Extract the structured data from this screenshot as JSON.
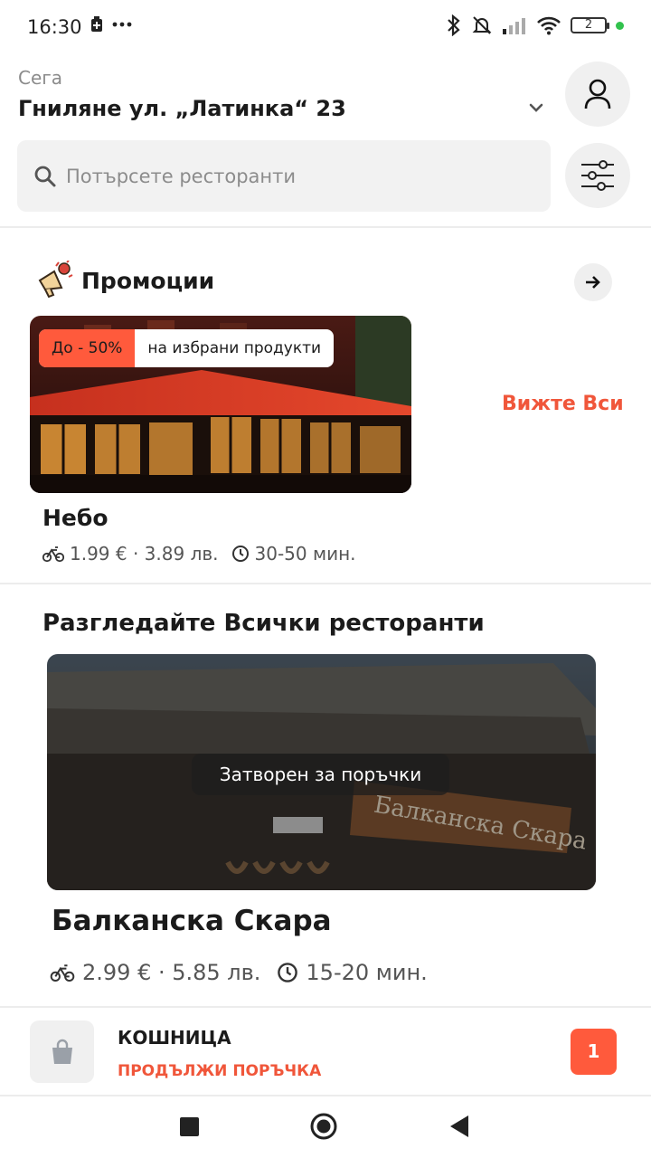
{
  "status_bar": {
    "time": "16:30",
    "battery": "2"
  },
  "header": {
    "now_label": "Сега",
    "address": "Гниляне ул. „Латинка“ 23"
  },
  "search": {
    "placeholder": "Потърсете ресторанти"
  },
  "promotions": {
    "title": "Промоции",
    "badge_discount": "До - 50%",
    "badge_text": "на избрани продукти",
    "see_all": "Вижте Всич",
    "restaurant": {
      "name": "Небо",
      "delivery": "1.99 € · 3.89 лв.",
      "time": "30-50 мин."
    }
  },
  "all_restaurants": {
    "title": "Разгледайте Всички ресторанти",
    "closed_label": "Затворен за поръчки",
    "restaurant": {
      "name": "Балканска Скара",
      "sign_text": "Балканска Скара",
      "delivery": "2.99 € · 5.85 лв.",
      "time": "15-20 мин."
    }
  },
  "basket": {
    "title": "КОШНИЦА",
    "subtitle": "ПРОДЪЛЖИ ПОРЪЧКА",
    "count": "1"
  },
  "colors": {
    "accent": "#ff5a3c",
    "accent_text": "#f0563a"
  }
}
